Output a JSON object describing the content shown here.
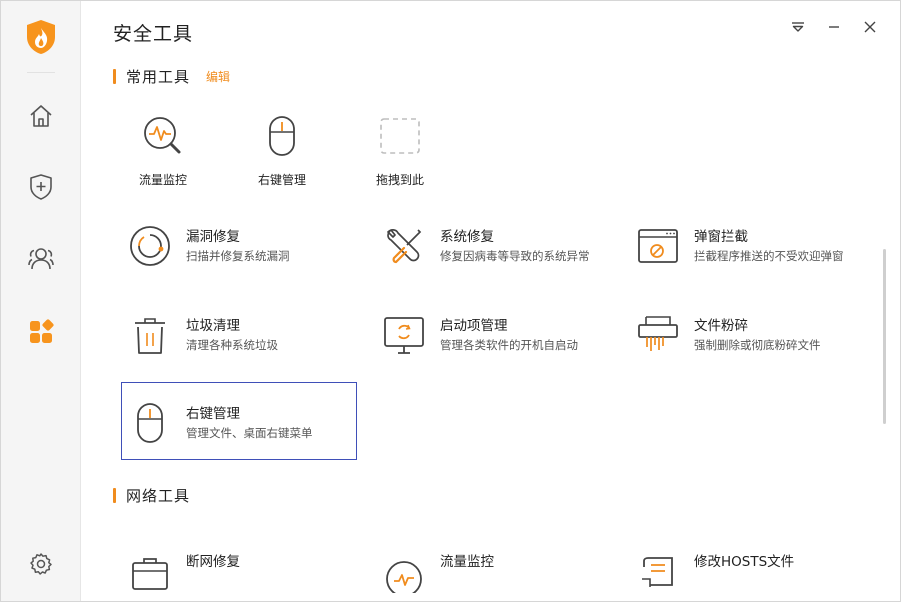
{
  "window": {
    "title": "安全工具"
  },
  "sidebar": {
    "items": [
      {
        "name": "home",
        "icon": "home-icon"
      },
      {
        "name": "protection",
        "icon": "shield-plus-icon"
      },
      {
        "name": "users",
        "icon": "users-icon"
      },
      {
        "name": "tools",
        "icon": "apps-icon",
        "active": true
      }
    ],
    "settings_icon": "gear-icon"
  },
  "sections": {
    "common": {
      "title": "常用工具",
      "edit_label": "编辑"
    },
    "network": {
      "title": "网络工具"
    }
  },
  "quick_tools": [
    {
      "label": "流量监控",
      "icon": "traffic-monitor-icon"
    },
    {
      "label": "右键管理",
      "icon": "mouse-icon"
    },
    {
      "label": "拖拽到此",
      "icon": "dashed-placeholder-icon"
    }
  ],
  "tools": [
    {
      "title": "漏洞修复",
      "desc": "扫描并修复系统漏洞",
      "icon": "vulnerability-fix-icon"
    },
    {
      "title": "系统修复",
      "desc": "修复因病毒等导致的系统异常",
      "icon": "wrench-screwdriver-icon"
    },
    {
      "title": "弹窗拦截",
      "desc": "拦截程序推送的不受欢迎弹窗",
      "icon": "popup-block-icon"
    },
    {
      "title": "垃圾清理",
      "desc": "清理各种系统垃圾",
      "icon": "trash-icon"
    },
    {
      "title": "启动项管理",
      "desc": "管理各类软件的开机自启动",
      "icon": "startup-monitor-icon"
    },
    {
      "title": "文件粉碎",
      "desc": "强制删除或彻底粉碎文件",
      "icon": "shredder-icon"
    },
    {
      "title": "右键管理",
      "desc": "管理文件、桌面右键菜单",
      "icon": "mouse-icon",
      "selected": true
    }
  ],
  "network_tools": [
    {
      "title": "断网修复",
      "icon": "network-repair-icon"
    },
    {
      "title": "流量监控",
      "icon": "traffic-gauge-icon"
    },
    {
      "title": "修改HOSTS文件",
      "icon": "hosts-file-icon"
    }
  ],
  "colors": {
    "accent": "#f08c1e",
    "selected_border": "#3f4fb8",
    "icon": "#444444"
  }
}
